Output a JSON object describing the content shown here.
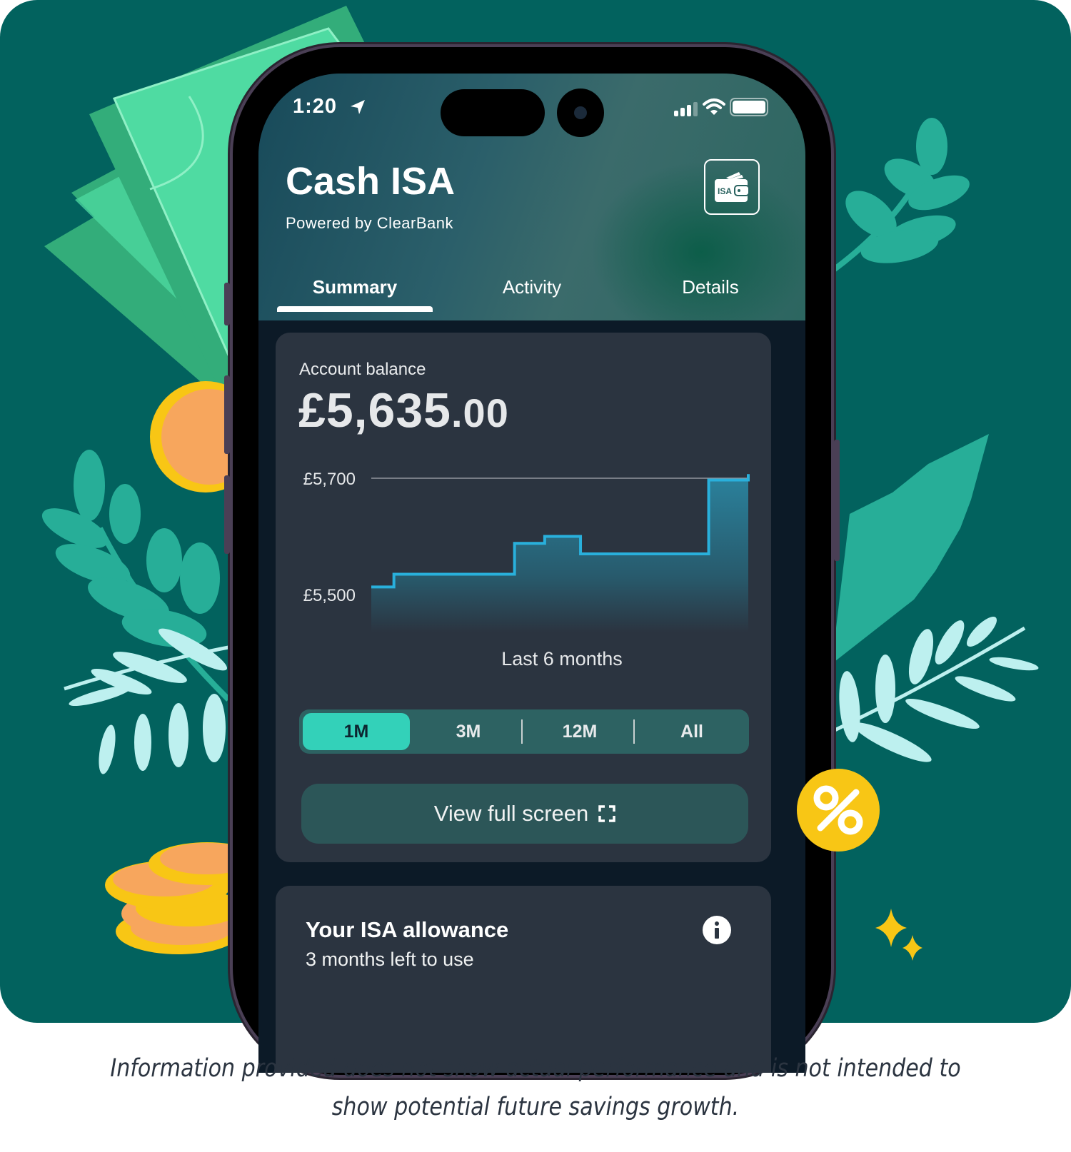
{
  "status_bar": {
    "time": "1:20",
    "icons": [
      "location-arrow-icon",
      "cellular-signal-icon",
      "wifi-icon",
      "battery-icon"
    ]
  },
  "header": {
    "title": "Cash ISA",
    "subtitle": "Powered by ClearBank",
    "isa_icon_label": "ISA"
  },
  "tabs": [
    {
      "label": "Summary",
      "active": true
    },
    {
      "label": "Activity",
      "active": false
    },
    {
      "label": "Details",
      "active": false
    }
  ],
  "balance_card": {
    "label": "Account balance",
    "amount_main": "£5,635",
    "amount_decimal": ".00",
    "chart_caption": "Last 6 months",
    "range_options": [
      {
        "label": "1M",
        "selected": true
      },
      {
        "label": "3M",
        "selected": false
      },
      {
        "label": "12M",
        "selected": false
      },
      {
        "label": "All",
        "selected": false
      }
    ],
    "fullscreen_label": "View full screen"
  },
  "allowance_card": {
    "title": "Your ISA allowance",
    "subtitle": "3 months left to use"
  },
  "disclaimer": {
    "line1": "Information provided does not show actual performance and is not intended to",
    "line2": "show potential future savings growth."
  },
  "colors": {
    "background": "#02625e",
    "line": "#29b0dc",
    "accent": "#33d1b9",
    "card": "#2b3440",
    "percent_badge": "#f8c615"
  },
  "chart_data": {
    "type": "line",
    "style": "step-area",
    "title": "Last 6 months",
    "xlabel": "",
    "ylabel": "",
    "y_ticks": [
      {
        "value": 5500,
        "label": "£5,500"
      },
      {
        "value": 5700,
        "label": "£5,700"
      }
    ],
    "ylim": [
      5420,
      5720
    ],
    "grid": true,
    "x": [
      0,
      0.06,
      0.33,
      0.38,
      0.46,
      0.555,
      0.895,
      1.0
    ],
    "values": [
      5513,
      5535,
      5535,
      5588,
      5600,
      5570,
      5697,
      5707
    ]
  }
}
